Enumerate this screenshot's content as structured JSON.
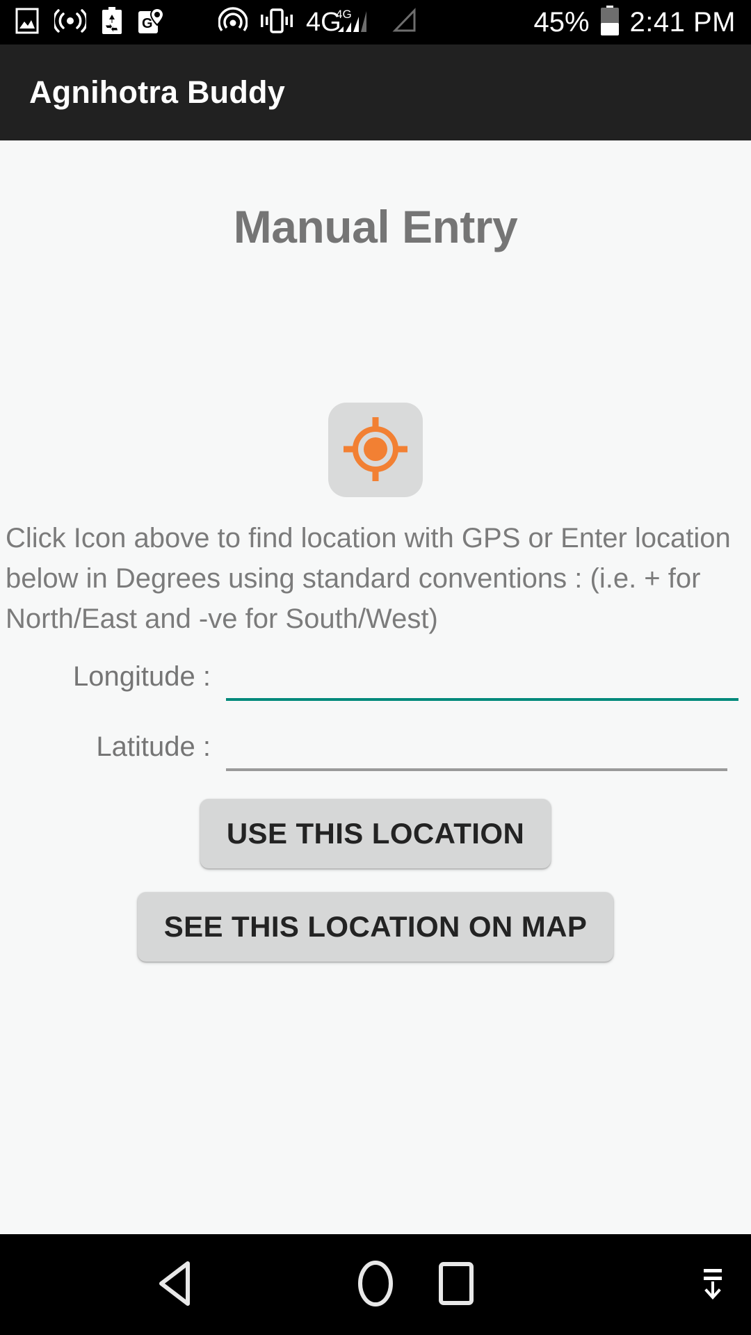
{
  "status_bar": {
    "icons_left": [
      "image-icon",
      "hotspot-icon",
      "battery-saver-recycle-icon",
      "google-maps-icon"
    ],
    "icons_mid": [
      "nfc-icon",
      "vibrate-icon",
      "4g-signal-icon",
      "sim2-no-signal-icon"
    ],
    "battery_percent": "45%",
    "clock": "2:41 PM"
  },
  "app_bar": {
    "title": "Agnihotra Buddy"
  },
  "main": {
    "page_title": "Manual Entry",
    "gps_icon": "gps-crosshair-icon",
    "instructions": "Click Icon above to find location with GPS or Enter location below in Degrees using standard conventions :\n (i.e. + for North/East and -ve for South/West)",
    "fields": [
      {
        "label": "Longitude :",
        "value": "",
        "placeholder": "",
        "focused": true
      },
      {
        "label": "Latitude :",
        "value": "",
        "placeholder": "",
        "focused": false
      }
    ],
    "buttons": [
      {
        "label": "USE THIS LOCATION"
      },
      {
        "label": "SEE THIS LOCATION ON MAP"
      }
    ]
  },
  "nav_bar": {
    "back": "back-triangle-icon",
    "home": "home-circle-icon",
    "recents": "recents-square-icon",
    "hide": "hide-keyboard-icon"
  },
  "colors": {
    "accent_orange": "#F28033",
    "focus_teal": "#00897B",
    "appbar_bg": "#212121",
    "page_bg": "#F7F8F8",
    "button_bg": "#D6D7D7",
    "text_grey": "#757575"
  }
}
